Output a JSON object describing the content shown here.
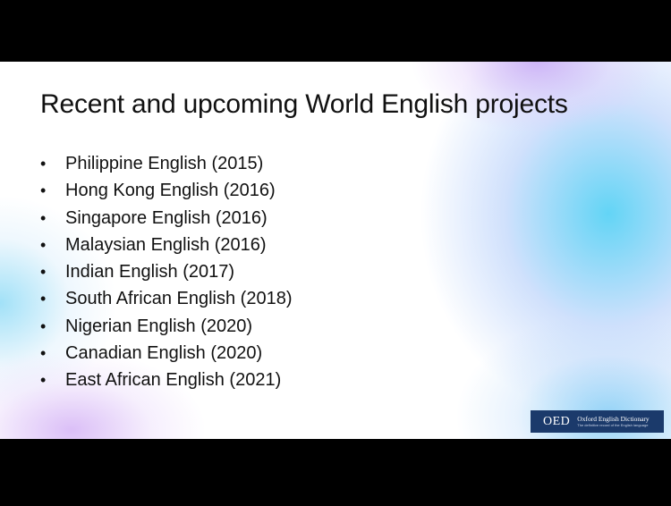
{
  "slide": {
    "title": "Recent and upcoming World English projects",
    "bullets": [
      "Philippine English (2015)",
      "Hong Kong English (2016)",
      "Singapore English (2016)",
      "Malaysian English (2016)",
      "Indian English (2017)",
      "South African English (2018)",
      "Nigerian English (2020)",
      "Canadian English (2020)",
      "East African English (2021)"
    ],
    "bullet_symbol": "•"
  },
  "logo": {
    "mark": "OED",
    "name": "Oxford English Dictionary",
    "tagline": "The definitive record of the English language",
    "background_color": "#1b3a6b"
  },
  "colors": {
    "letterbox": "#000000",
    "slide_background": "#ffffff",
    "text": "#111111",
    "gradient_cyan": "#5ad2f5",
    "gradient_violet": "#c8aaf5"
  }
}
